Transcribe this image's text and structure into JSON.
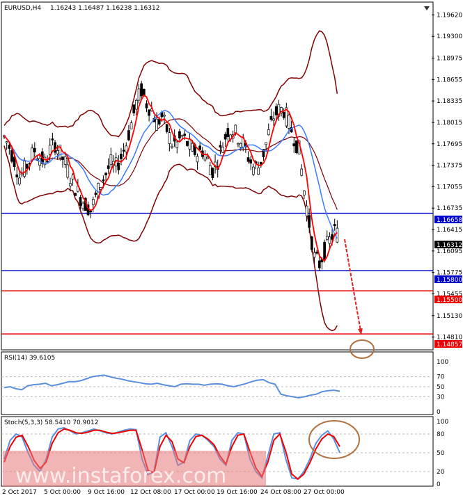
{
  "header": {
    "symbol": "EURUSD,H4",
    "ohlc": "1.16243 1.16487 1.16238 1.16312"
  },
  "chart_data": [
    {
      "type": "candlestick",
      "ylim": [
        1.1465,
        1.1978
      ],
      "y_ticks": [
        "1.19620",
        "1.19300",
        "1.18975",
        "1.18655",
        "1.18335",
        "1.18015",
        "1.17695",
        "1.17375",
        "1.17055",
        "1.16735",
        "1.16415",
        "1.16095",
        "1.15775",
        "1.15455",
        "1.15130",
        "1.14810"
      ],
      "x_ticks": [
        "2 Oct 2017",
        "5 Oct 00:00",
        "9 Oct 16:00",
        "12 Oct 08:00",
        "17 Oct 00:00",
        "19 Oct 16:00",
        "24 Oct 08:00",
        "27 Oct 00:00"
      ],
      "close_path": [
        1.178,
        1.1765,
        1.1745,
        1.172,
        1.173,
        1.1745,
        1.176,
        1.175,
        1.174,
        1.176,
        1.177,
        1.1755,
        1.174,
        1.172,
        1.1705,
        1.169,
        1.168,
        1.167,
        1.169,
        1.171,
        1.1725,
        1.174,
        1.1735,
        1.175,
        1.177,
        1.18,
        1.183,
        1.185,
        1.183,
        1.182,
        1.18,
        1.181,
        1.179,
        1.177,
        1.177,
        1.178,
        1.177,
        1.176,
        1.1755,
        1.176,
        1.1745,
        1.173,
        1.1745,
        1.177,
        1.179,
        1.179,
        1.178,
        1.177,
        1.175,
        1.1735,
        1.1735,
        1.1755,
        1.1785,
        1.181,
        1.182,
        1.182,
        1.18,
        1.178,
        1.176,
        1.17,
        1.165,
        1.16,
        1.159,
        1.161,
        1.1625,
        1.164,
        1.1631
      ],
      "levels": [
        {
          "label": "1.16658",
          "value": 1.16658,
          "color": "#0000cc"
        },
        {
          "label": "1.15800",
          "value": 1.158,
          "color": "#0000cc"
        },
        {
          "label": "1.15500",
          "value": 1.155,
          "color": "#ee0000"
        },
        {
          "label": "1.14857",
          "value": 1.14857,
          "color": "#ee0000"
        }
      ],
      "current_price": {
        "label": "1.16312",
        "value": 1.16312
      },
      "arrow": {
        "from_value": 1.1627,
        "to_value": 1.1484,
        "color": "#dd2222"
      },
      "colors": {
        "bollinger": "#800000",
        "ma_fast": "#ff0000",
        "ma_slow": "#3a7bff",
        "candle": "#000000"
      }
    },
    {
      "type": "line",
      "title": "RSI(14) 39.6105",
      "ylim": [
        0,
        100
      ],
      "y_ticks": [
        "100",
        "70",
        "50",
        "30",
        "0"
      ],
      "values": [
        48,
        50,
        46,
        44,
        52,
        54,
        55,
        57,
        52,
        54,
        57,
        60,
        60,
        62,
        66,
        70,
        72,
        73,
        70,
        67,
        65,
        62,
        60,
        58,
        56,
        55,
        57,
        54,
        52,
        50,
        55,
        56,
        55,
        55,
        53,
        55,
        56,
        55,
        52,
        50,
        53,
        56,
        60,
        63,
        64,
        58,
        55,
        35,
        32,
        30,
        28,
        30,
        33,
        35,
        40,
        42,
        43,
        41
      ],
      "color": "#5b8fdd"
    },
    {
      "type": "line",
      "title": "Stoch(5,3,3) 58.5410 70.9012",
      "ylim": [
        0,
        100
      ],
      "y_ticks": [
        "100",
        "80",
        "50",
        "20",
        "0"
      ],
      "series": [
        {
          "values": [
            40,
            70,
            80,
            75,
            50,
            30,
            20,
            40,
            75,
            88,
            90,
            85,
            80,
            82,
            85,
            88,
            85,
            82,
            80,
            83,
            86,
            88,
            87,
            40,
            15,
            20,
            75,
            82,
            60,
            30,
            35,
            70,
            80,
            78,
            70,
            60,
            40,
            30,
            70,
            82,
            80,
            40,
            20,
            10,
            45,
            80,
            82,
            40,
            10,
            8,
            20,
            40,
            65,
            78,
            85,
            72,
            50
          ],
          "color": "#5b8fdd"
        },
        {
          "values": [
            35,
            60,
            75,
            78,
            60,
            38,
            25,
            35,
            65,
            82,
            88,
            86,
            82,
            81,
            83,
            86,
            86,
            83,
            81,
            82,
            84,
            86,
            86,
            55,
            22,
            18,
            60,
            78,
            68,
            40,
            34,
            60,
            76,
            78,
            72,
            63,
            45,
            32,
            60,
            78,
            80,
            52,
            26,
            12,
            35,
            70,
            80,
            52,
            16,
            8,
            16,
            34,
            56,
            72,
            80,
            76,
            60
          ],
          "color": "#ee0000"
        }
      ]
    }
  ],
  "price_labels": {
    "l1": "1.16658",
    "l2": "1.16312",
    "l3": "1.15800",
    "l4": "1.15500",
    "l5": "1.14857"
  },
  "watermark": "www.instaforex.com"
}
